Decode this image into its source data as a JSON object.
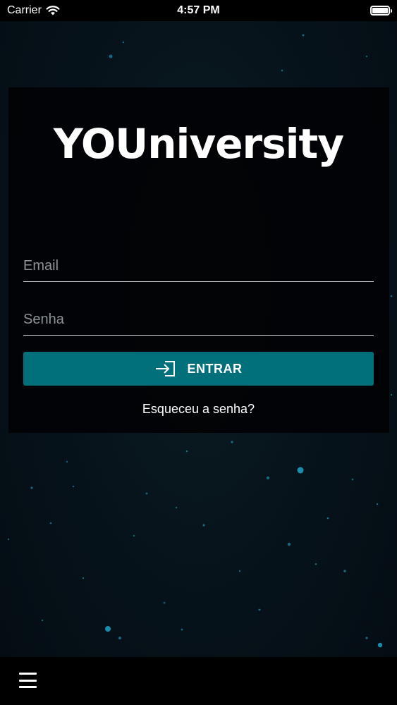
{
  "status_bar": {
    "carrier": "Carrier",
    "time": "4:57 PM"
  },
  "logo": {
    "text": "YOUniversity"
  },
  "login_form": {
    "email_placeholder": "Email",
    "password_placeholder": "Senha",
    "login_button_label": "ENTRAR",
    "forgot_password_label": "Esqueceu a senha?"
  },
  "icons": {
    "wifi": "wifi-icon",
    "battery": "battery-icon",
    "login": "login-icon",
    "menu": "menu-icon"
  },
  "colors": {
    "button": "#02707a",
    "stars": "#1fa3c4"
  }
}
